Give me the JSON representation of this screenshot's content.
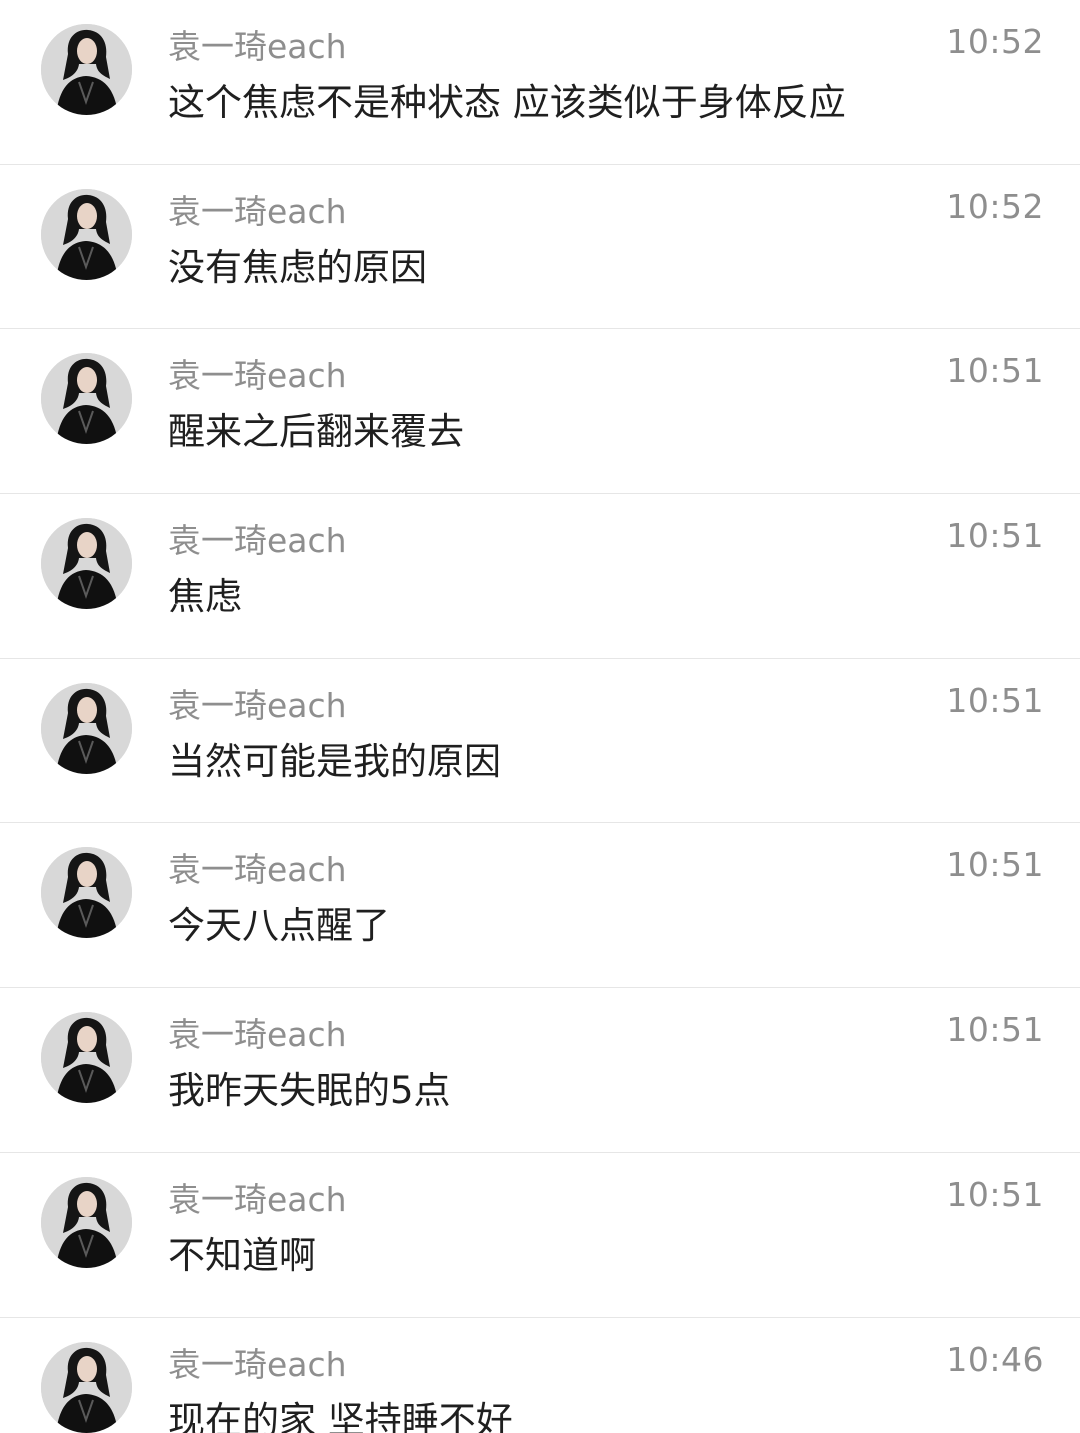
{
  "messages": [
    {
      "sender": "袁一琦each",
      "text": "这个焦虑不是种状态 应该类似于身体反应",
      "time": "10:52",
      "avatar_icon": "user-avatar-icon"
    },
    {
      "sender": "袁一琦each",
      "text": "没有焦虑的原因",
      "time": "10:52",
      "avatar_icon": "user-avatar-icon"
    },
    {
      "sender": "袁一琦each",
      "text": "醒来之后翻来覆去",
      "time": "10:51",
      "avatar_icon": "user-avatar-icon"
    },
    {
      "sender": "袁一琦each",
      "text": "焦虑",
      "time": "10:51",
      "avatar_icon": "user-avatar-icon"
    },
    {
      "sender": "袁一琦each",
      "text": "当然可能是我的原因",
      "time": "10:51",
      "avatar_icon": "user-avatar-icon"
    },
    {
      "sender": "袁一琦each",
      "text": "今天八点醒了",
      "time": "10:51",
      "avatar_icon": "user-avatar-icon"
    },
    {
      "sender": "袁一琦each",
      "text": "我昨天失眠的5点",
      "time": "10:51",
      "avatar_icon": "user-avatar-icon"
    },
    {
      "sender": "袁一琦each",
      "text": "不知道啊",
      "time": "10:51",
      "avatar_icon": "user-avatar-icon"
    },
    {
      "sender": "袁一琦each",
      "text": "现在的家 坚持睡不好",
      "time": "10:46",
      "avatar_icon": "user-avatar-icon"
    }
  ],
  "colors": {
    "background": "#ffffff",
    "divider": "#e6e6e6",
    "name_text": "#8e8e8e",
    "message_text": "#1f1f1f",
    "time_text": "#8e8e8e"
  }
}
